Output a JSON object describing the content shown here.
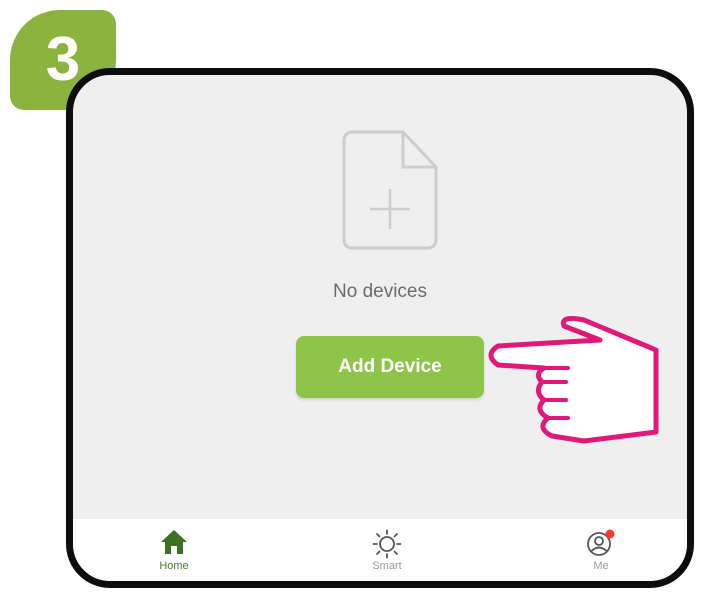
{
  "step": {
    "number": "3",
    "color": "#8ab43e"
  },
  "empty_state": {
    "text": "No devices",
    "icon": "add-file-icon"
  },
  "add_button": {
    "label": "Add Device",
    "color": "#8cc54a"
  },
  "tabbar": {
    "tabs": [
      {
        "label": "Home",
        "icon": "home-icon",
        "active": true
      },
      {
        "label": "Smart",
        "icon": "sun-icon",
        "active": false
      },
      {
        "label": "Me",
        "icon": "user-icon",
        "active": false,
        "notification_dot": true
      }
    ]
  },
  "pointer": {
    "icon": "pointing-hand-icon",
    "color": "#e0187a"
  }
}
